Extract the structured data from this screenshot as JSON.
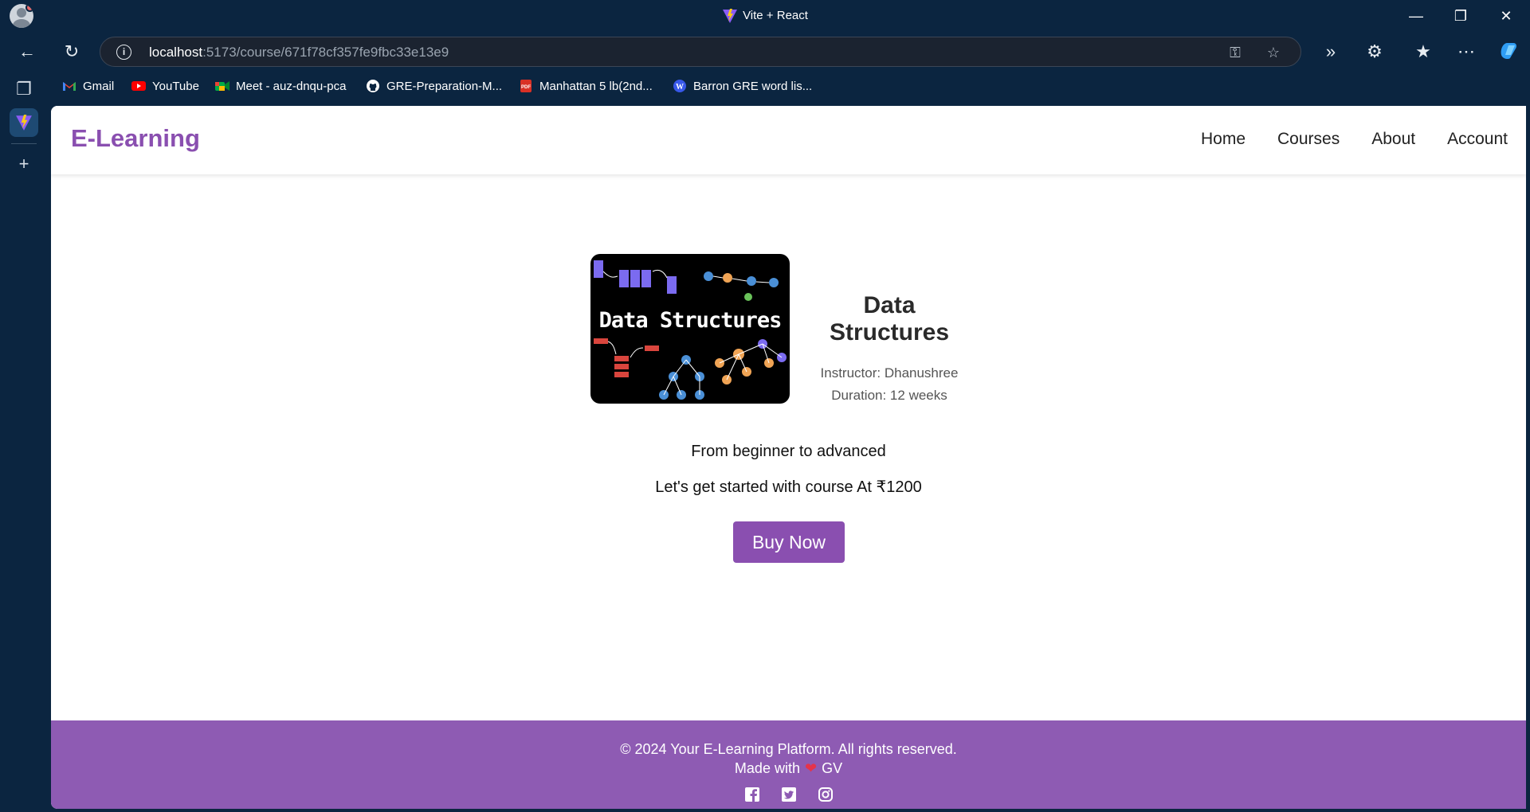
{
  "browser": {
    "tab_title": "Vite + React",
    "url_host": "localhost",
    "url_path": ":5173/course/671f78cf357fe9fbc33e13e9",
    "bookmarks": [
      {
        "label": "Gmail",
        "icon": "gmail-icon"
      },
      {
        "label": "YouTube",
        "icon": "youtube-icon"
      },
      {
        "label": "Meet - auz-dnqu-pca",
        "icon": "meet-icon"
      },
      {
        "label": "GRE-Preparation-M...",
        "icon": "github-icon"
      },
      {
        "label": "Manhattan 5 lb(2nd...",
        "icon": "pdf-icon"
      },
      {
        "label": "Barron GRE word lis...",
        "icon": "wordpress-icon"
      }
    ]
  },
  "site": {
    "logo": "E-Learning",
    "nav": [
      "Home",
      "Courses",
      "About",
      "Account"
    ]
  },
  "course": {
    "image_text": "Data Structures",
    "title": "Data Structures",
    "instructor": "Instructor: Dhanushree",
    "duration": "Duration: 12 weeks",
    "description": "From beginner to advanced",
    "price_line": "Let's get started with course At ₹1200",
    "buy_label": "Buy Now"
  },
  "footer": {
    "copyright": "© 2024 Your E-Learning Platform. All rights reserved.",
    "made_prefix": "Made with",
    "made_suffix": "GV",
    "socials": [
      "facebook-icon",
      "twitter-icon",
      "instagram-icon"
    ]
  },
  "colors": {
    "accent": "#8a4fb0",
    "footer_bg": "#8e5bb3",
    "chrome_bg": "#0b2540"
  }
}
